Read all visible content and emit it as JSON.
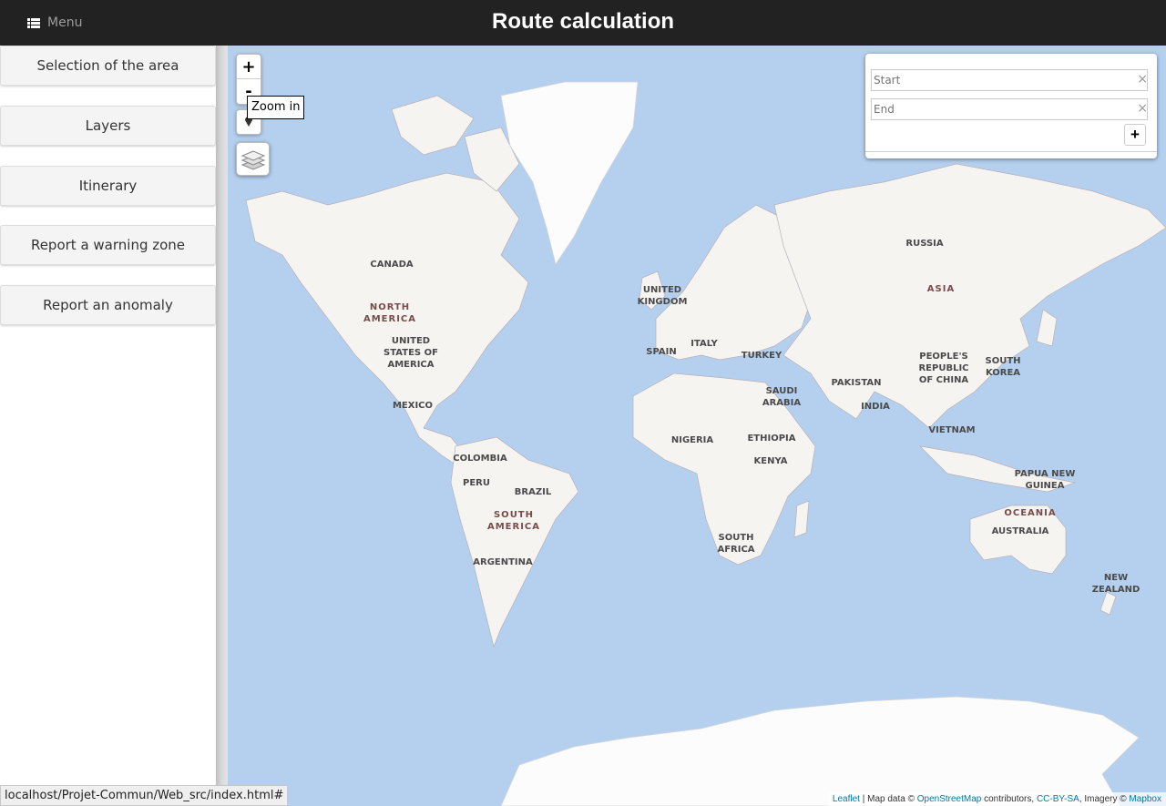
{
  "header": {
    "menu_label": "Menu",
    "title": "Route calculation"
  },
  "sidebar": {
    "items": [
      {
        "label": "Selection of the area"
      },
      {
        "label": "Layers"
      },
      {
        "label": "Itinerary"
      },
      {
        "label": "Report a warning zone"
      },
      {
        "label": "Report an anomaly"
      }
    ]
  },
  "map": {
    "zoom_in": "+",
    "zoom_out": "-",
    "tooltip": "Zoom in",
    "labels": {
      "greenland_none": "",
      "canada": "CANADA",
      "north_america": "NORTH\nAMERICA",
      "usa": "UNITED\nSTATES OF\nAMERICA",
      "mexico": "MEXICO",
      "colombia": "COLOMBIA",
      "peru": "PERU",
      "brazil": "BRAZIL",
      "south_america": "SOUTH\nAMERICA",
      "argentina": "ARGENTINA",
      "uk": "UNITED\nKINGDOM",
      "spain": "SPAIN",
      "italy": "ITALY",
      "turkey": "TURKEY",
      "saudi": "SAUDI\nARABIA",
      "nigeria": "NIGERIA",
      "ethiopia": "ETHIOPIA",
      "kenya": "KENYA",
      "south_africa": "SOUTH\nAFRICA",
      "russia": "RUSSIA",
      "asia": "ASIA",
      "china": "PEOPLE'S\nREPUBLIC\nOF CHINA",
      "south_korea": "SOUTH\nKOREA",
      "pakistan": "PAKISTAN",
      "india": "INDIA",
      "vietnam": "VIETNAM",
      "png": "PAPUA NEW\nGUINEA",
      "oceania": "OCEANIA",
      "australia": "AUSTRALIA",
      "nz": "NEW\nZEALAND"
    }
  },
  "routing": {
    "start_placeholder": "Start",
    "end_placeholder": "End",
    "clear": "×",
    "add": "+"
  },
  "attribution": {
    "leaflet": "Leaflet",
    "text1": " | Map data © ",
    "osm": "OpenStreetMap",
    "text2": " contributors, ",
    "license": "CC-BY-SA",
    "text3": ", Imagery © ",
    "mapbox": "Mapbox"
  },
  "statusbar": {
    "url": "localhost/Projet-Commun/Web_src/index.html#"
  },
  "colors": {
    "header": "#222222",
    "ocean": "#b5d0ef",
    "land": "#f6f4f1",
    "ice": "#fdfcfc",
    "link": "#0078a8"
  }
}
